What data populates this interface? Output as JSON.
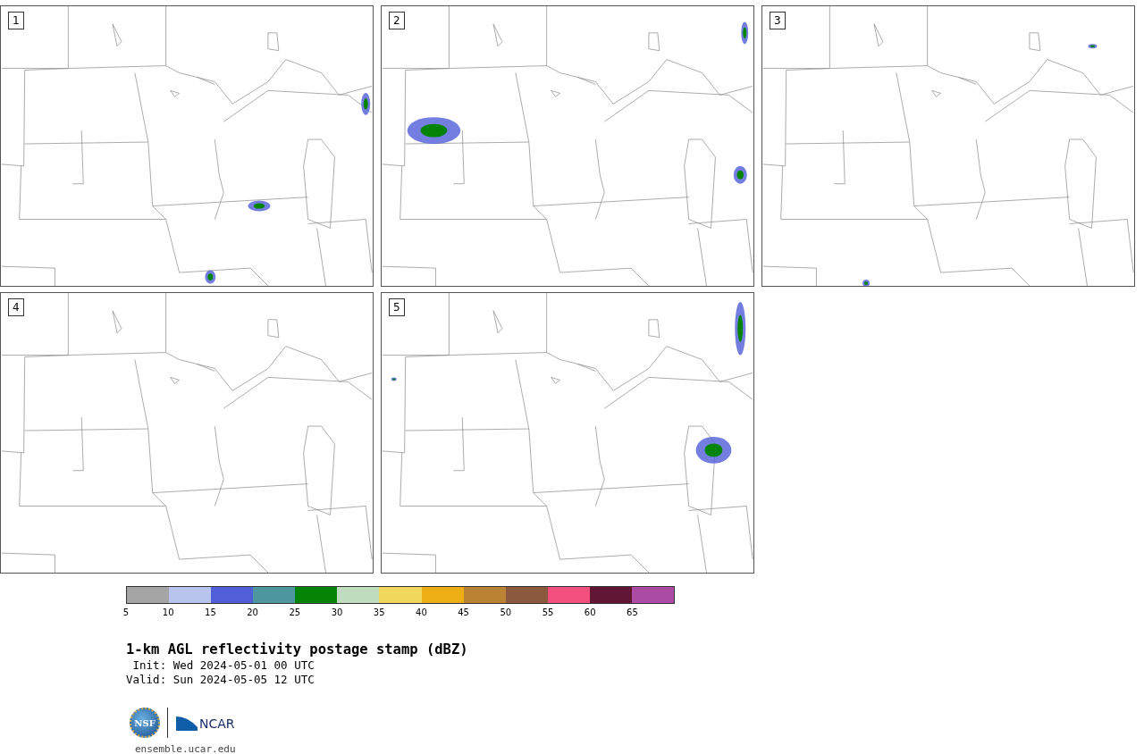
{
  "panels": [
    {
      "label": "1"
    },
    {
      "label": "2"
    },
    {
      "label": "3"
    },
    {
      "label": "4"
    },
    {
      "label": "5"
    }
  ],
  "colorbar": {
    "segments": [
      {
        "color": "#a5a5a5"
      },
      {
        "color": "#b8c3ee"
      },
      {
        "color": "#505ed8"
      },
      {
        "color": "#4f979e"
      },
      {
        "color": "#048304"
      },
      {
        "color": "#bfdcbf"
      },
      {
        "color": "#efd85b"
      },
      {
        "color": "#eeae16"
      },
      {
        "color": "#b98333"
      },
      {
        "color": "#8b5a3e"
      },
      {
        "color": "#f35080"
      },
      {
        "color": "#611635"
      },
      {
        "color": "#ab4ba4"
      }
    ],
    "ticks": [
      "5",
      "10",
      "15",
      "20",
      "25",
      "30",
      "35",
      "40",
      "45",
      "50",
      "55",
      "60",
      "65"
    ]
  },
  "title": "1-km AGL reflectivity postage stamp (dBZ)",
  "init": " Init: Wed 2024-05-01 00 UTC",
  "valid": "Valid: Sun 2024-05-05 12 UTC",
  "logos": {
    "nsf": "NSF",
    "ncar": "NCAR"
  },
  "site": "ensemble.ucar.edu"
}
